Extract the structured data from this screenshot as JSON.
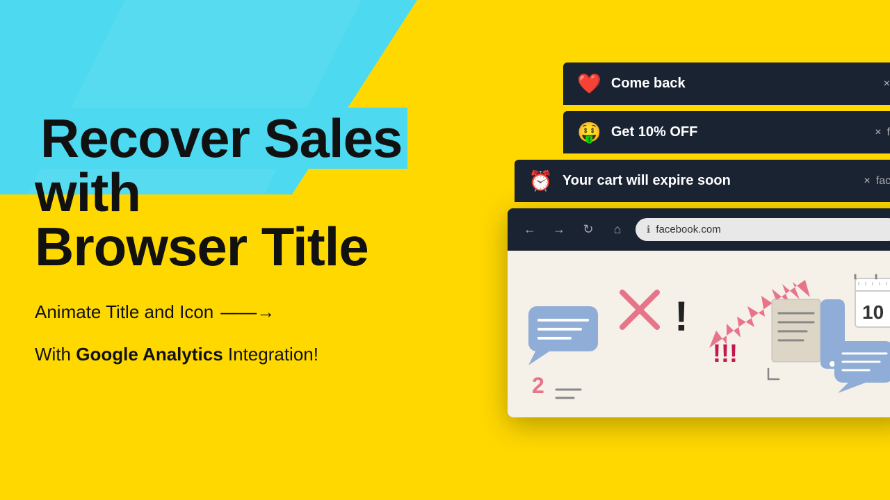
{
  "background": {
    "cyan_color": "#4DD9F0",
    "yellow_color": "#FFD800",
    "dark_color": "#1a2332"
  },
  "left": {
    "title_line1": "Recover Sales",
    "title_line2": "with",
    "title_line3": "Browser Title",
    "subtitle": "Animate Title and Icon",
    "subtitle_arrow": "——→",
    "analytics_text_prefix": "With ",
    "analytics_bold": "Google Analytics",
    "analytics_text_suffix": " Integration!"
  },
  "notifications": [
    {
      "id": "notif-1",
      "icon": "❤️",
      "text": "Come back",
      "close": "×",
      "right_label": ""
    },
    {
      "id": "notif-2",
      "icon": "🤑",
      "text": "Get 10% OFF",
      "close": "×",
      "right_label": "f"
    },
    {
      "id": "notif-3",
      "icon": "⏰",
      "text": "Your cart will expire soon",
      "close": "×",
      "right_label": "face"
    }
  ],
  "browser": {
    "address": "facebook.com",
    "nav_back": "←",
    "nav_forward": "→",
    "nav_refresh": "↻",
    "nav_home": "⌂"
  }
}
